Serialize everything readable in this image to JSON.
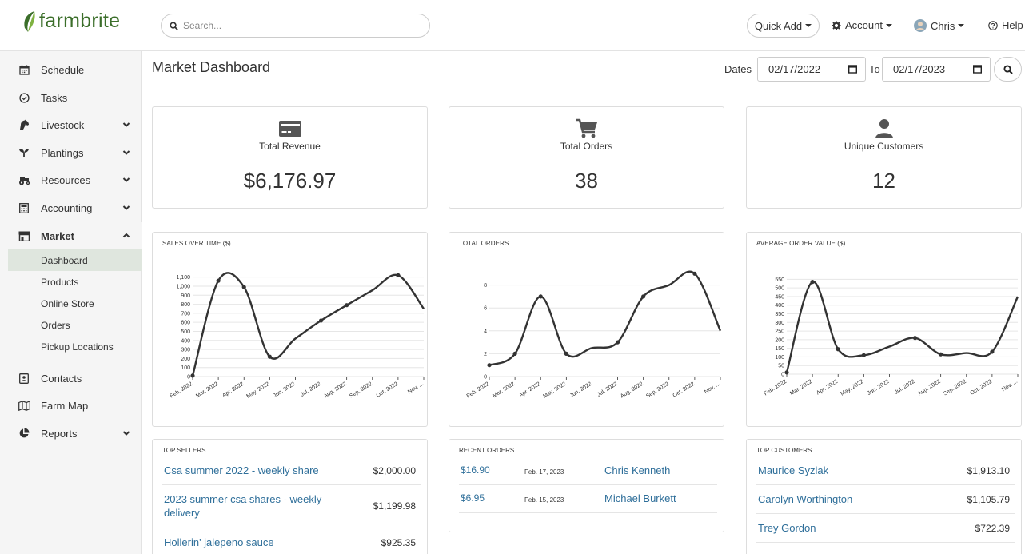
{
  "app": {
    "brand": "farmbrite",
    "brand_color": "#3b6e2a",
    "accent_link_color": "#2f6f9a"
  },
  "header": {
    "search_placeholder": "Search...",
    "quick_add": "Quick Add",
    "account": "Account",
    "user": "Chris",
    "help": "Help"
  },
  "sidebar": {
    "items": [
      {
        "label": "Schedule",
        "icon": "calendar-icon"
      },
      {
        "label": "Tasks",
        "icon": "check-circle-icon"
      },
      {
        "label": "Livestock",
        "icon": "horse-icon"
      },
      {
        "label": "Plantings",
        "icon": "seedling-icon"
      },
      {
        "label": "Resources",
        "icon": "tractor-icon"
      },
      {
        "label": "Accounting",
        "icon": "calculator-icon"
      },
      {
        "label": "Market",
        "icon": "store-icon"
      },
      {
        "label": "Contacts",
        "icon": "contact-card-icon"
      },
      {
        "label": "Farm Map",
        "icon": "map-icon"
      },
      {
        "label": "Reports",
        "icon": "pie-chart-icon"
      }
    ],
    "market_sub": [
      "Dashboard",
      "Products",
      "Online Store",
      "Orders",
      "Pickup Locations"
    ],
    "active_sub": "Dashboard"
  },
  "main": {
    "title": "Market Dashboard",
    "dates_label": "Dates",
    "date_from": "02/17/2022",
    "to_label": "To",
    "date_to": "02/17/2023"
  },
  "stats": [
    {
      "label": "Total Revenue",
      "value": "$6,176.97",
      "icon": "credit-card-icon"
    },
    {
      "label": "Total Orders",
      "value": "38",
      "icon": "cart-icon"
    },
    {
      "label": "Unique Customers",
      "value": "12",
      "icon": "user-icon"
    }
  ],
  "chart_data": [
    {
      "type": "line",
      "title": "SALES OVER TIME ($)",
      "categories": [
        "Feb. 2022",
        "Mar. 2022",
        "Apr. 2022",
        "May. 2022",
        "Jun. 2022",
        "Jul. 2022",
        "Aug. 2022",
        "Sep. 2022",
        "Oct. 2022",
        "Nov. 2022"
      ],
      "tick_labels": [
        "Feb. 2022",
        "Mar. 2022",
        "Apr. 2022",
        "May. 2022",
        "Jun. 2022",
        "Jul. 2022",
        "Aug. 2022",
        "Sep. 2022",
        "Oct. 2022",
        "Nov. ..."
      ],
      "series": [
        {
          "values": [
            10,
            1060,
            990,
            220,
            null,
            620,
            790,
            null,
            1120,
            750
          ]
        }
      ],
      "yticks": [
        "0",
        "100",
        "200",
        "300",
        "400",
        "500",
        "600",
        "700",
        "800",
        "900",
        "1,000",
        "1,100"
      ],
      "ylim": [
        0,
        1150
      ],
      "grid": true
    },
    {
      "type": "line",
      "title": "TOTAL ORDERS",
      "categories": [
        "Feb. 2022",
        "Mar. 2022",
        "Apr. 2022",
        "May. 2022",
        "Jun. 2022",
        "Jul. 2022",
        "Aug. 2022",
        "Sep. 2022",
        "Oct. 2022",
        "Nov. 2022"
      ],
      "tick_labels": [
        "Feb. 2022",
        "Mar. 2022",
        "Apr. 2022",
        "May. 2022",
        "Jun. 2022",
        "Jul. 2022",
        "Aug. 2022",
        "Sep. 2022",
        "Oct. 2022",
        "Nov. ..."
      ],
      "series": [
        {
          "values": [
            1,
            2,
            7,
            2,
            null,
            3,
            7,
            null,
            9,
            4
          ]
        }
      ],
      "yticks": [
        "0",
        "2",
        "4",
        "6",
        "8"
      ],
      "ylim": [
        0,
        9.3
      ],
      "grid": true
    },
    {
      "type": "line",
      "title": "AVERAGE ORDER VALUE ($)",
      "categories": [
        "Feb. 2022",
        "Mar. 2022",
        "Apr. 2022",
        "May. 2022",
        "Jun. 2022",
        "Jul. 2022",
        "Aug. 2022",
        "Sep. 2022",
        "Oct. 2022",
        "Nov. 2022"
      ],
      "tick_labels": [
        "Feb. 2022",
        "Mar. 2022",
        "Apr. 2022",
        "May. 2022",
        "Jun. 2022",
        "Jul. 2022",
        "Aug. 2022",
        "Sep. 2022",
        "Oct. 2022",
        "Nov. ..."
      ],
      "series": [
        {
          "values": [
            10,
            535,
            145,
            110,
            null,
            210,
            115,
            null,
            130,
            450
          ]
        }
      ],
      "yticks": [
        "0",
        "50",
        "100",
        "150",
        "200",
        "250",
        "300",
        "350",
        "400",
        "450",
        "500",
        "550"
      ],
      "ylim": [
        0,
        575
      ],
      "grid": true
    }
  ],
  "top_sellers": {
    "title": "TOP SELLERS",
    "rows": [
      {
        "name": "Csa summer 2022 - weekly share",
        "amount": "$2,000.00"
      },
      {
        "name": "2023 summer csa shares - weekly delivery",
        "amount": "$1,199.98"
      },
      {
        "name": "Hollerin' jalepeno sauce",
        "amount": "$925.35"
      }
    ]
  },
  "recent_orders": {
    "title": "RECENT ORDERS",
    "rows": [
      {
        "amount": "$16.90",
        "date": "Feb. 17, 2023",
        "customer": "Chris Kenneth"
      },
      {
        "amount": "$6.95",
        "date": "Feb. 15, 2023",
        "customer": "Michael Burkett"
      }
    ]
  },
  "top_customers": {
    "title": "TOP CUSTOMERS",
    "rows": [
      {
        "name": "Maurice Syzlak",
        "amount": "$1,913.10"
      },
      {
        "name": "Carolyn Worthington",
        "amount": "$1,105.79"
      },
      {
        "name": "Trey Gordon",
        "amount": "$722.39"
      }
    ]
  }
}
